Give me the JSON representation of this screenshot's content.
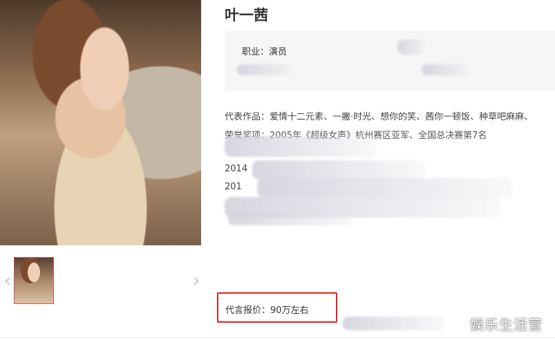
{
  "profile": {
    "name": "叶一茜",
    "occupation": "职业：演员",
    "works": "代表作品：爱情十二元素、一撇·时光、想你的笑、茜你一顿饭、种草吧麻麻、",
    "awards": "荣誉奖项：2005年《超级女声》杭州赛区亚军、全国总决赛第7名",
    "year_lines": [
      "2014",
      "201"
    ],
    "endorsement_price": "代言报价：90万左右"
  },
  "gallery": {
    "prev_label": "‹",
    "next_label": "›"
  },
  "watermark": "娱乐生活营"
}
